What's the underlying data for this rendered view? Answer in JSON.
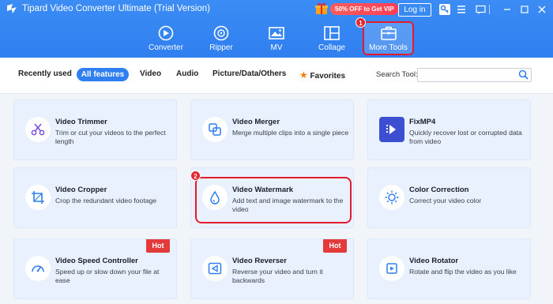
{
  "app": {
    "title": "Tipard Video Converter Ultimate (Trial Version)",
    "promo": "50% OFF to Get VIP",
    "login": "Log in"
  },
  "nav": [
    {
      "label": "Converter",
      "icon": "converter-icon"
    },
    {
      "label": "Ripper",
      "icon": "ripper-icon"
    },
    {
      "label": "MV",
      "icon": "mv-icon"
    },
    {
      "label": "Collage",
      "icon": "collage-icon"
    },
    {
      "label": "More Tools",
      "icon": "toolbox-icon"
    }
  ],
  "badges": {
    "step1": "1",
    "step2": "2"
  },
  "filters": {
    "recently_used": "Recently used",
    "all_features": "All features",
    "video": "Video",
    "audio": "Audio",
    "picture": "Picture/Data/Others",
    "favorites": "Favorites",
    "search_label": "Search Tool:",
    "search_placeholder": ""
  },
  "cards": [
    {
      "title": "Video Trimmer",
      "desc": "Trim or cut your videos to the perfect length",
      "icon": "scissors-icon"
    },
    {
      "title": "Video Merger",
      "desc": "Merge multiple clips into a single piece",
      "icon": "merge-icon"
    },
    {
      "title": "FixMP4",
      "desc": "Quickly recover lost or corrupted data from video",
      "icon": "fixmp4-icon"
    },
    {
      "title": "Video Cropper",
      "desc": "Crop the redundant video footage",
      "icon": "crop-icon"
    },
    {
      "title": "Video Watermark",
      "desc": "Add text and image watermark to the video",
      "icon": "watermark-icon"
    },
    {
      "title": "Color Correction",
      "desc": "Correct your video color",
      "icon": "color-correction-icon"
    },
    {
      "title": "Video Speed Controller",
      "desc": "Speed up or slow down your file at ease",
      "icon": "speed-icon",
      "hot": "Hot"
    },
    {
      "title": "Video Reverser",
      "desc": "Reverse your video and turn it backwards",
      "icon": "reverse-icon",
      "hot": "Hot"
    },
    {
      "title": "Video Rotator",
      "desc": "Rotate and flip the video as you like",
      "icon": "rotate-icon"
    }
  ],
  "colors": {
    "accent": "#2f7ff0",
    "highlight": "#e21c2c",
    "hot": "#e33b3b"
  }
}
